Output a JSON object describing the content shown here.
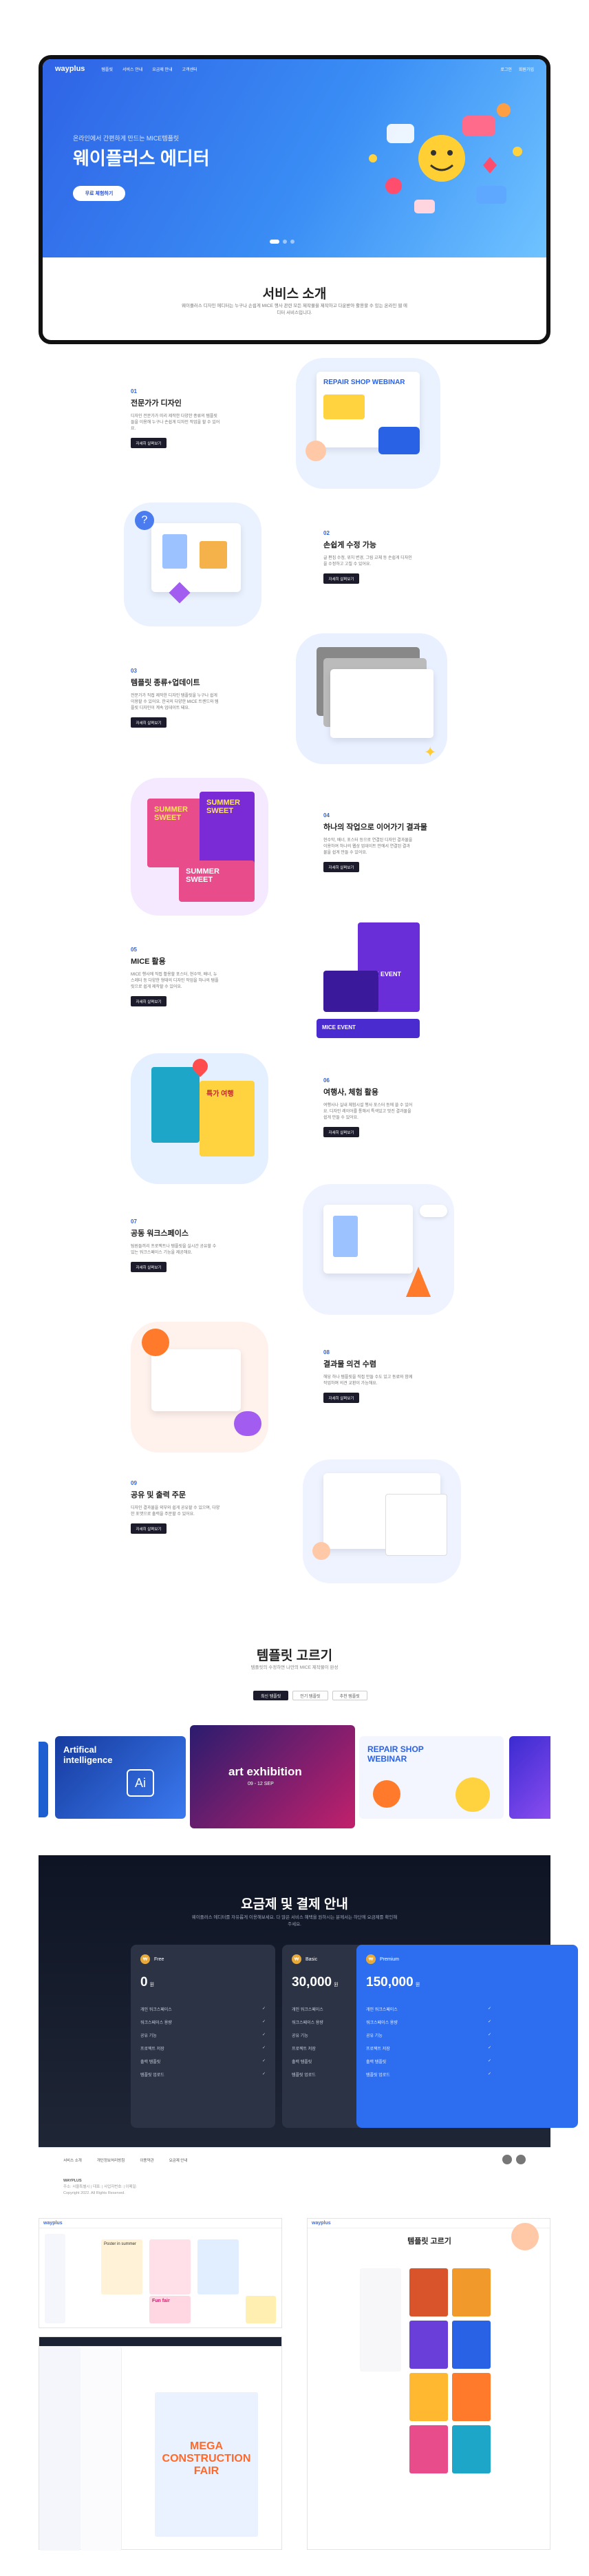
{
  "nav": {
    "logo": "wayplus",
    "links": [
      "템플릿",
      "서비스 안내",
      "요금제 안내",
      "고객센터"
    ],
    "login": "로그인",
    "signup": "회원가입"
  },
  "hero": {
    "subtitle": "온라인에서 간편하게 만드는 MICE템플릿",
    "title": "웨이플러스 에디터",
    "button": "무료 체험하기"
  },
  "service": {
    "title": "서비스 소개",
    "desc": "웨이플러스 디자인 에디터는 누구나 손쉽게 MICE 행사 관련 모든 제작물을 제작하고 다운받아 활용할 수 있는 온라인 웹 에디터 서비스입니다."
  },
  "features": [
    {
      "num": "01",
      "title": "전문가가 디자인",
      "desc": "디자인 전문가가 미리 제작한 다양한 종류의 템플릿들을 이용해 누구나 손쉽게 디자인 작업을 할 수 있어요.",
      "button": "자세히 살펴보기"
    },
    {
      "num": "02",
      "title": "손쉽게 수정 가능",
      "desc": "글 편집 수정, 위치 변경, 그림 교체 등 손쉽게 디자인을 수정하고 고칠 수 있어요.",
      "button": "자세히 살펴보기"
    },
    {
      "num": "03",
      "title": "템플릿 종류+업데이트",
      "desc": "전문가가 직접 제작한 디자인 템플릿을 누구나 쉽게 이용할 수 있어요. 한국의 다양한 MICE 트렌드와 템플릿 디자인이 계속 업데이트 돼요.",
      "button": "자세히 살펴보기"
    },
    {
      "num": "04",
      "title": "하나의 작업으로 이어가기 결과물",
      "desc": "현수막, 배너, 포스터 등으로 연결된 디자인 결과물을 이용하여 하나의 웹상 업데이트 안에서 연결된 결과물을 쉽게 만들 수 있어요.",
      "button": "자세히 살펴보기"
    },
    {
      "num": "05",
      "title": "MICE 활용",
      "desc": "MICE 행사에 직접 활용할 포스터, 현수막, 배너, 뉴스레터 등 다양한 형태의 디자인 작업을 하나의 템플릿으로 쉽게 제작할 수 있어요.",
      "button": "자세히 살펴보기"
    },
    {
      "num": "06",
      "title": "여행사, 체험 활용",
      "desc": "여행사나 실내 체험시설 행사 포스터 등에 쓸 수 있어요. 디자인 레이어를 통해서 특색있고 멋진 결과물을 쉽게 만들 수 있어요.",
      "button": "자세히 살펴보기"
    },
    {
      "num": "07",
      "title": "공동 워크스페이스",
      "desc": "팀원들끼리 프로젝트나 템플릿을 실시간 공유할 수 있는 워크스페이스 기능을 제공해요.",
      "button": "자세히 살펴보기"
    },
    {
      "num": "08",
      "title": "결과물 의견 수렴",
      "desc": "해당 하나 템플릿을 직접 만들 수도 있고 동료와 함께 작업하며 의견 교환이 가능해요.",
      "button": "자세히 살펴보기"
    },
    {
      "num": "09",
      "title": "공유 및 출력 주문",
      "desc": "디자인 결과물을 외부와 쉽게 공유할 수 있으며, 다양한 포맷으로 출력을 주문할 수 있어요.",
      "button": "자세히 살펴보기"
    }
  ],
  "illustrations": {
    "f1_card": "REPAIR SHOP WEBINAR",
    "f3_label": "SUMMER SWEET",
    "f5_label": "MICE EVENT",
    "f6_label": "특가 여행"
  },
  "templates": {
    "title": "템플릿 고르기",
    "subtitle": "템플릿의 수정하면 나만의 MICE 제작물이 완성",
    "tabs": [
      "최신 템플릿",
      "인기 템플릿",
      "추천 템플릿"
    ],
    "cards": [
      {
        "title": "Artifical intelligence",
        "tag": "Ai"
      },
      {
        "title": "art exhibition",
        "date": "09 - 12 SEP"
      },
      {
        "title": "REPAIR SHOP WEBINAR"
      }
    ]
  },
  "pricing": {
    "title": "요금제 및 결제 안내",
    "subtitle": "웨이플러스 에디터를 자유롭게 이용해보세요. 다 많은 서비스 혜택을 원하시는 분께서는 하단에 요금제를 확인해 주세요.",
    "plans": [
      {
        "name": "Free",
        "price": "0",
        "unit": "원",
        "features": [
          "개인 워크스페이스",
          "워크스페이스 용량",
          "공유 기능",
          "프로젝트 저장",
          "출력 템플릿",
          "템플릿 업로드"
        ]
      },
      {
        "name": "Basic",
        "price": "30,000",
        "unit": "원",
        "features": [
          "개인 워크스페이스",
          "워크스페이스 용량",
          "공유 기능",
          "프로젝트 저장",
          "출력 템플릿",
          "템플릿 업로드"
        ]
      },
      {
        "name": "Premium",
        "price": "150,000",
        "unit": "원",
        "features": [
          "개인 워크스페이스",
          "워크스페이스 용량",
          "공유 기능",
          "프로젝트 저장",
          "출력 템플릿",
          "템플릿 업로드"
        ]
      }
    ]
  },
  "footer": {
    "links": [
      "서비스 소개",
      "개인정보처리방침",
      "이용약관",
      "요금제 안내"
    ],
    "company": "WAYPLUS",
    "info": "주소: 서울특별시 | 대표: | 사업자번호: | 이메일:",
    "copyright": "Copyright 2022. All Rights Reserved."
  },
  "screens": {
    "editor_logo": "wayplus",
    "tpl_title": "템플릿 고르기",
    "mega_title": "MEGA CONSTRUCTION FAIR",
    "fun_fair": "Fun fair",
    "poster_title": "Poster in summer"
  },
  "colors": {
    "accent": "#2a62e6",
    "dark": "#1b1b2b",
    "hero_start": "#2f63e6",
    "hero_end": "#6fc3ff"
  }
}
